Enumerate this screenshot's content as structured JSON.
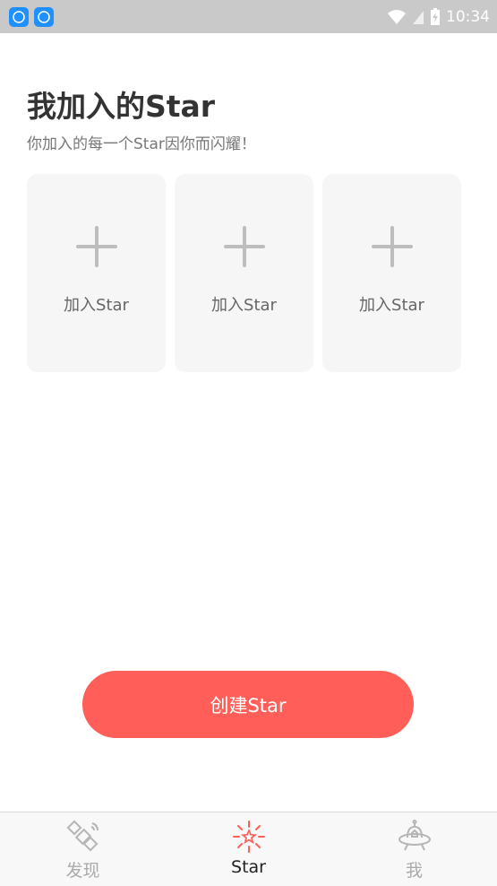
{
  "status_bar": {
    "time": "10:34"
  },
  "header": {
    "title": "我加入的Star",
    "subtitle": "你加入的每一个Star因你而闪耀！"
  },
  "cards": [
    {
      "label": "加入Star"
    },
    {
      "label": "加入Star"
    },
    {
      "label": "加入Star"
    }
  ],
  "create_button": {
    "label": "创建Star"
  },
  "bottom_nav": {
    "items": [
      {
        "label": "发现",
        "icon": "satellite-icon",
        "active": false
      },
      {
        "label": "Star",
        "icon": "star-burst-icon",
        "active": true
      },
      {
        "label": "我",
        "icon": "ufo-icon",
        "active": false
      }
    ]
  },
  "colors": {
    "accent": "#ff5f58",
    "card_bg": "#f6f6f6",
    "status_bar_bg": "#c9c9c9"
  }
}
